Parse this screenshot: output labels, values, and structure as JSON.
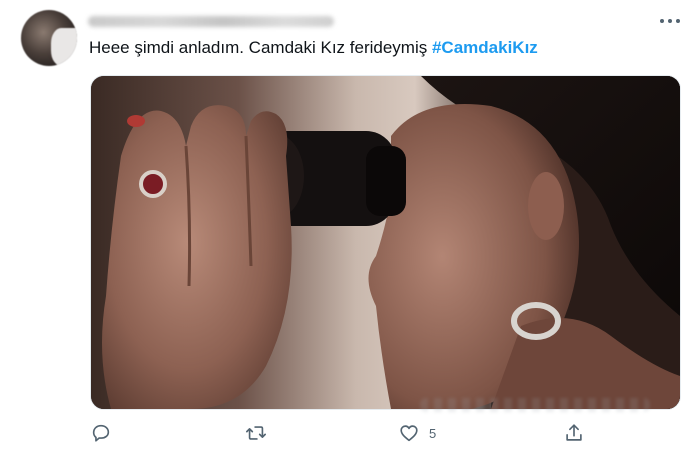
{
  "tweet": {
    "text_plain": "Heee şimdi anladım. Camdaki Kız ferideymiş ",
    "hashtag": "#CamdakiKız",
    "more_icon": "more-horizontal-icon",
    "media_description_icon": "photo"
  },
  "actions": {
    "reply_icon": "reply-icon",
    "retweet_icon": "retweet-icon",
    "like_icon": "like-icon",
    "like_count": "5",
    "share_icon": "share-icon"
  },
  "colors": {
    "text": "#0f1419",
    "hashtag": "#1d9bf0",
    "icon": "#536471"
  }
}
